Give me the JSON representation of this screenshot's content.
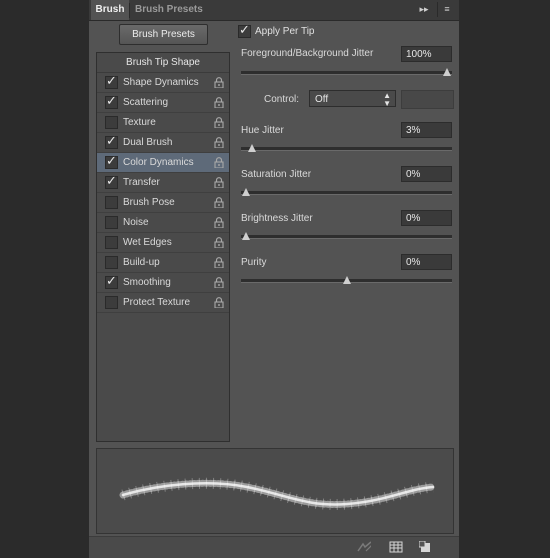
{
  "tabs": {
    "active": "Brush",
    "inactive": "Brush Presets",
    "menu_arrows": "▸▸",
    "menu_icon": "≡"
  },
  "presets_button": "Brush Presets",
  "list": {
    "header": "Brush Tip Shape",
    "items": [
      {
        "label": "Shape Dynamics",
        "checked": true,
        "selected": false
      },
      {
        "label": "Scattering",
        "checked": true,
        "selected": false
      },
      {
        "label": "Texture",
        "checked": false,
        "selected": false
      },
      {
        "label": "Dual Brush",
        "checked": true,
        "selected": false
      },
      {
        "label": "Color Dynamics",
        "checked": true,
        "selected": true
      },
      {
        "label": "Transfer",
        "checked": true,
        "selected": false
      },
      {
        "label": "Brush Pose",
        "checked": false,
        "selected": false
      },
      {
        "label": "Noise",
        "checked": false,
        "selected": false
      },
      {
        "label": "Wet Edges",
        "checked": false,
        "selected": false
      },
      {
        "label": "Build-up",
        "checked": false,
        "selected": false
      },
      {
        "label": "Smoothing",
        "checked": true,
        "selected": false
      },
      {
        "label": "Protect Texture",
        "checked": false,
        "selected": false
      }
    ]
  },
  "settings": {
    "apply_per_tip": {
      "label": "Apply Per Tip",
      "checked": true
    },
    "fg_bg_jitter": {
      "label": "Foreground/Background Jitter",
      "value": "100%",
      "fraction": 1.0
    },
    "control": {
      "label": "Control:",
      "value": "Off"
    },
    "hue_jitter": {
      "label": "Hue Jitter",
      "value": "3%",
      "fraction": 0.03
    },
    "saturation_jitter": {
      "label": "Saturation Jitter",
      "value": "0%",
      "fraction": 0.0
    },
    "brightness_jitter": {
      "label": "Brightness Jitter",
      "value": "0%",
      "fraction": 0.0
    },
    "purity": {
      "label": "Purity",
      "value": "0%",
      "fraction": 0.5
    }
  },
  "icons": {
    "lock": "lock-icon",
    "checkmark": "✓",
    "bottom_bar": [
      "toggle-live-tip-icon",
      "brush-grid-icon",
      "new-preset-icon"
    ]
  },
  "colors": {
    "selected_row": "#5e6a79",
    "panel": "#535353",
    "background": "#2b2b2b"
  }
}
